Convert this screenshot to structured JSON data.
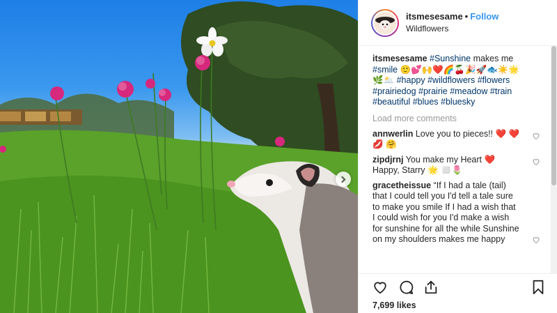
{
  "header": {
    "username": "itsmesesame",
    "separator": "•",
    "follow_label": "Follow",
    "location": "Wildflowers"
  },
  "caption": {
    "username": "itsmesesame",
    "segments": [
      {
        "text": "#Sunshine",
        "tag": true
      },
      {
        "text": " makes me ",
        "tag": false
      },
      {
        "text": "#smile",
        "tag": true
      },
      {
        "text": " 🙂💕🙌❤️🌈🍒🎉🚀🐟☀️🌟 🌿🌥️ ",
        "tag": false
      },
      {
        "text": "#happy",
        "tag": true
      },
      {
        "text": " ",
        "tag": false
      },
      {
        "text": "#wildflowers",
        "tag": true
      },
      {
        "text": " ",
        "tag": false
      },
      {
        "text": "#flowers",
        "tag": true
      },
      {
        "text": " ",
        "tag": false
      },
      {
        "text": "#prairiedog",
        "tag": true
      },
      {
        "text": " ",
        "tag": false
      },
      {
        "text": "#prairie",
        "tag": true
      },
      {
        "text": " ",
        "tag": false
      },
      {
        "text": "#meadow",
        "tag": true
      },
      {
        "text": " ",
        "tag": false
      },
      {
        "text": "#train",
        "tag": true
      },
      {
        "text": " ",
        "tag": false
      },
      {
        "text": "#beautiful",
        "tag": true
      },
      {
        "text": " ",
        "tag": false
      },
      {
        "text": "#blues",
        "tag": true
      },
      {
        "text": " ",
        "tag": false
      },
      {
        "text": "#bluesky",
        "tag": true
      }
    ]
  },
  "load_more_label": "Load more comments",
  "comments": [
    {
      "username": "annwerlin",
      "text": "Love you to pieces!! ❤️ ❤️ 💋 🤗"
    },
    {
      "username": "zipdjrnj",
      "text": "You make my Heart ❤️ Happy, Starry 🌟 ◻️🌷"
    },
    {
      "username": "gracetheissue",
      "text": "“If I had a tale (tail) that I could tell you I'd tell a tale sure to make you smile If I had a wish that I could wish for you I'd make a wish for sunshine for all the while Sunshine on my shoulders makes me happy"
    }
  ],
  "likes_label": "7,699 likes",
  "colors": {
    "link": "#003569",
    "follow": "#3897f0",
    "muted": "#999999"
  },
  "icons": {
    "like": "heart-icon",
    "comment": "comment-icon",
    "share": "share-icon",
    "save": "bookmark-icon",
    "next": "chevron-right-icon"
  }
}
